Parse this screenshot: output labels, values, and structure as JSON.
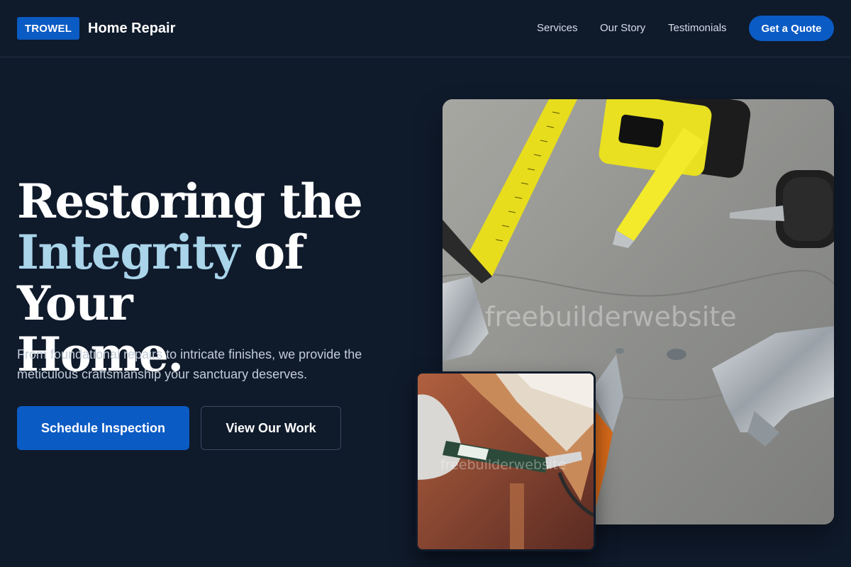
{
  "header": {
    "logo_badge": "TROWEL",
    "brand_name": "Home Repair",
    "nav": [
      "Services",
      "Our Story",
      "Testimonials"
    ],
    "cta": "Get a Quote"
  },
  "hero": {
    "headline_line1": "Restoring the",
    "headline_accent": "Integrity",
    "headline_line2_rest": " of Your",
    "headline_line3": "Home.",
    "subtext": "From foundational repairs to intricate finishes, we provide the meticulous craftsmanship your sanctuary deserves.",
    "primary_button": "Schedule Inspection",
    "secondary_button": "View Our Work"
  },
  "images": {
    "main_watermark": "freebuilderwebsite",
    "inset_watermark": "freebuilderwebsite"
  },
  "colors": {
    "background": "#0f1a2b",
    "accent_blue": "#0b5bc4",
    "headline_accent": "#a9d4ea"
  }
}
